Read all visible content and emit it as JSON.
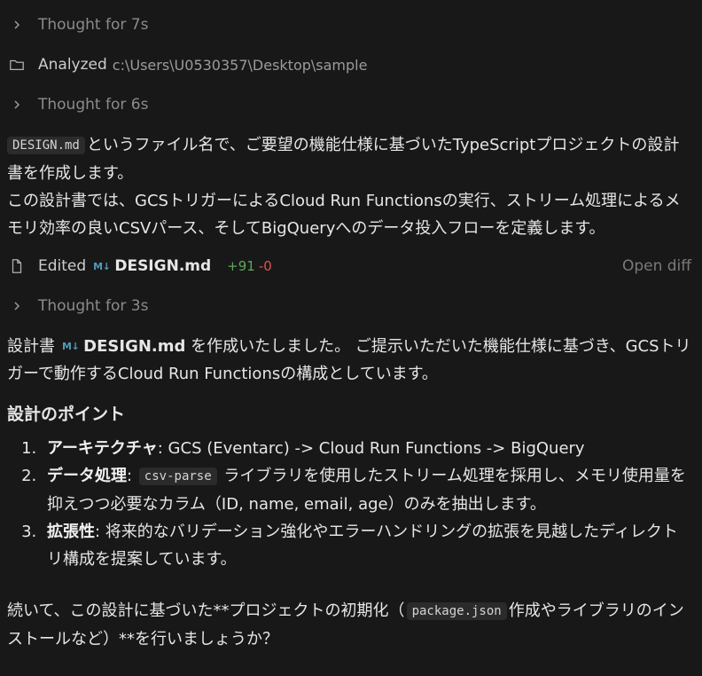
{
  "thoughts": [
    {
      "label": "Thought for 7s"
    },
    {
      "label": "Thought for 6s"
    },
    {
      "label": "Thought for 3s"
    }
  ],
  "analyzed": {
    "label": "Analyzed",
    "path": "c:\\Users\\U0530357\\Desktop\\sample"
  },
  "intro": {
    "code": "DESIGN.md",
    "line1": "というファイル名で、ご要望の機能仕様に基づいたTypeScriptプロジェクトの設計書を作成します。",
    "line2": "この設計書では、GCSトリガーによるCloud Run Functionsの実行、ストリーム処理によるメモリ効率の良いCSVパース、そしてBigQueryへのデータ投入フローを定義します。"
  },
  "edited": {
    "label": "Edited",
    "badge": "M↓",
    "file": "DESIGN.md",
    "additions": "+91",
    "deletions": "-0",
    "open_diff": "Open diff"
  },
  "summary": {
    "prefix": "設計書",
    "badge": "M↓",
    "file": "DESIGN.md",
    "text": "を作成いたしました。 ご提示いただいた機能仕様に基づき、GCSトリガーで動作するCloud Run Functionsの構成としています。"
  },
  "points": {
    "heading": "設計のポイント",
    "items": [
      {
        "term": "アーキテクチャ",
        "sep": ": ",
        "text": "GCS (Eventarc) -> Cloud Run Functions -> BigQuery",
        "code": "",
        "text2": ""
      },
      {
        "term": "データ処理",
        "sep": ": ",
        "text": "",
        "code": "csv-parse",
        "text2": "ライブラリを使用したストリーム処理を採用し、メモリ使用量を抑えつつ必要なカラム（ID, name, email, age）のみを抽出します。"
      },
      {
        "term": "拡張性",
        "sep": ": ",
        "text": "将来的なバリデーション強化やエラーハンドリングの拡張を見越したディレクトリ構成を提案しています。",
        "code": "",
        "text2": ""
      }
    ]
  },
  "followup": {
    "text1": "続いて、この設計に基づいた**プロジェクトの初期化（",
    "code": "package.json",
    "text2": "作成やライブラリのインストールなど）**を行いましょうか？"
  }
}
